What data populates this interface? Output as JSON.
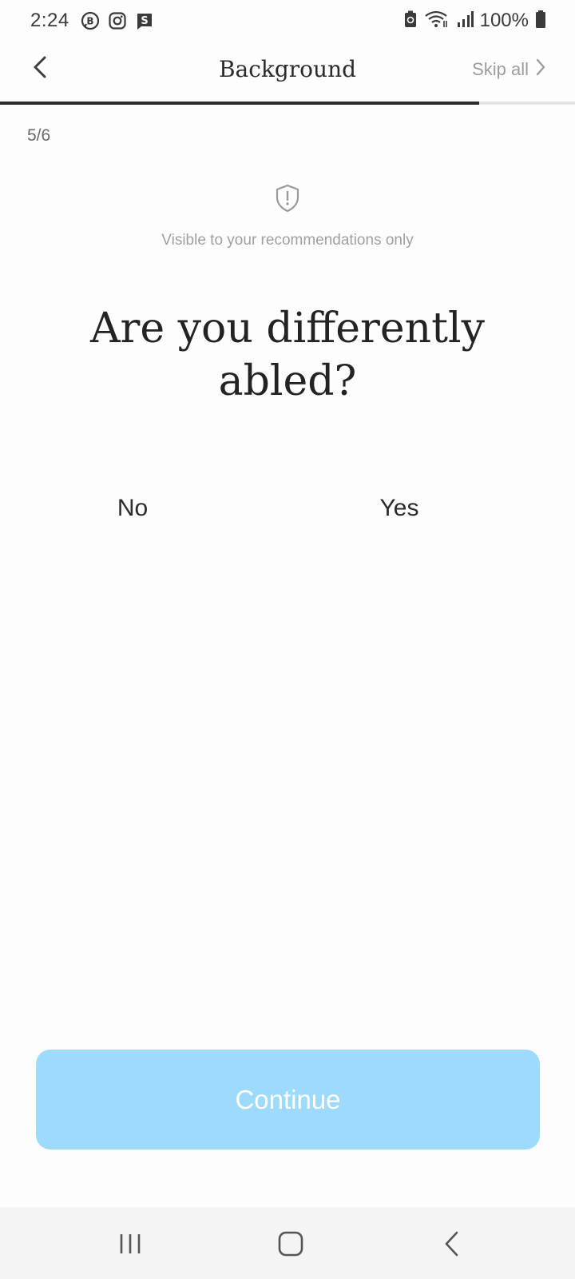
{
  "status_bar": {
    "time": "2:24",
    "battery": "100%",
    "app_icons": [
      "b-chat-icon",
      "instagram-icon",
      "s-app-icon"
    ]
  },
  "header": {
    "title": "Background",
    "skip_label": "Skip all",
    "progress": 0.833
  },
  "step": {
    "counter": "5/6"
  },
  "visibility": {
    "icon": "shield-alert-icon",
    "note": "Visible to your recommendations only"
  },
  "question": {
    "text": "Are you differently abled?",
    "options": [
      {
        "label": "No"
      },
      {
        "label": "Yes"
      }
    ]
  },
  "footer": {
    "continue_label": "Continue",
    "continue_color": "#9ddafc"
  },
  "nav_bar": {
    "icons": [
      "recent-apps-icon",
      "home-icon",
      "back-icon"
    ]
  }
}
